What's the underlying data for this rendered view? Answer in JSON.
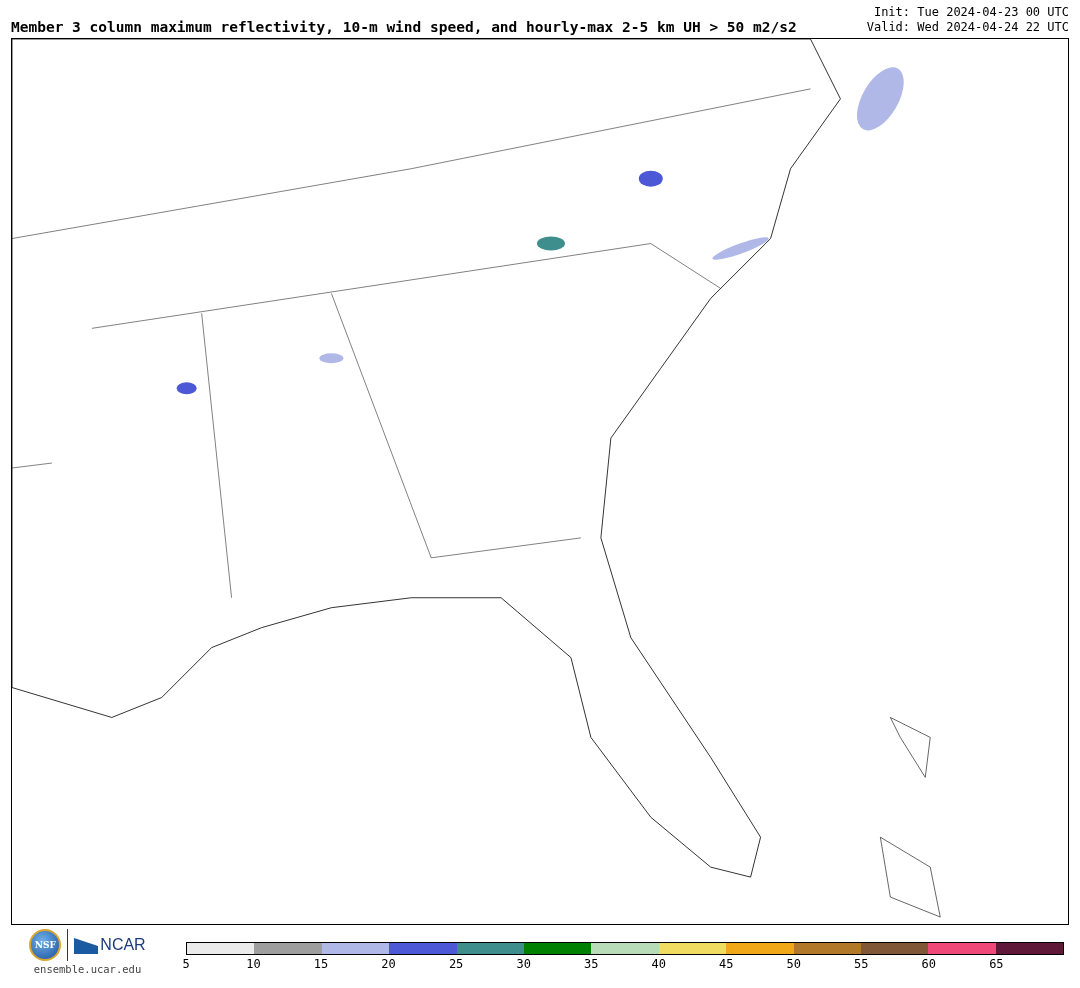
{
  "header": {
    "title": "Member 3 column maximum reflectivity, 10-m wind speed, and hourly-max 2-5 km UH > 50 m2/s2",
    "init": "Init: Tue 2024-04-23 00 UTC",
    "valid": "Valid: Wed 2024-04-24 22 UTC"
  },
  "logos": {
    "nsf": "NSF",
    "ncar": "NCAR",
    "url": "ensemble.ucar.edu"
  },
  "legend": {
    "segments": [
      {
        "label": "5",
        "color": "#ebebeb"
      },
      {
        "label": "10",
        "color": "#9e9e9e"
      },
      {
        "label": "15",
        "color": "#b0b8e8"
      },
      {
        "label": "20",
        "color": "#4d58d6"
      },
      {
        "label": "25",
        "color": "#3f8e8e"
      },
      {
        "label": "30",
        "color": "#008000"
      },
      {
        "label": "35",
        "color": "#b8dcb8"
      },
      {
        "label": "40",
        "color": "#f0dc60"
      },
      {
        "label": "45",
        "color": "#f0a818"
      },
      {
        "label": "50",
        "color": "#b07828"
      },
      {
        "label": "55",
        "color": "#805838"
      },
      {
        "label": "60",
        "color": "#f04878"
      },
      {
        "label": "65",
        "color": "#601838"
      }
    ]
  }
}
